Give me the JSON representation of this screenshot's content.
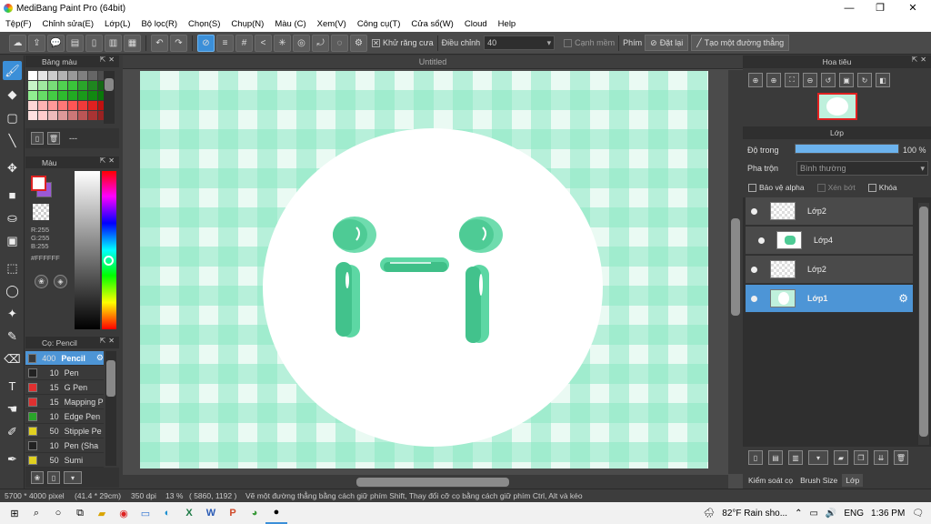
{
  "window": {
    "title": "MediBang Paint Pro (64bit)"
  },
  "menu": [
    "Tệp(F)",
    "Chỉnh sửa(E)",
    "Lớp(L)",
    "Bộ lọc(R)",
    "Chọn(S)",
    "Chụp(N)",
    "Màu (C)",
    "Xem(V)",
    "Công cụ(T)",
    "Cửa sổ(W)",
    "Cloud",
    "Help"
  ],
  "toolbar": {
    "antialias_label": "Khử răng cưa",
    "adjust_label": "Điều chỉnh",
    "adjust_value": "40",
    "soft_edge_label": "Cạnh mềm",
    "key_label": "Phím",
    "reset_label": "Đặt lại",
    "straight_line_label": "Tạo một đường thẳng"
  },
  "palette_panel": {
    "title": "Bảng màu",
    "extra_label": "---"
  },
  "color_panel": {
    "title": "Màu",
    "r": "R:255",
    "g": "G:255",
    "b": "B:255",
    "hex": "#FFFFFF",
    "primary_color": "#ffffff",
    "secondary_color": "#9b59d6"
  },
  "brush_panel": {
    "title": "Cọ: Pencil",
    "brushes": [
      {
        "size": "400",
        "name": "Pencil",
        "color": "#3a3a3a"
      },
      {
        "size": "10",
        "name": "Pen",
        "color": "#222222"
      },
      {
        "size": "15",
        "name": "G Pen",
        "color": "#e03030"
      },
      {
        "size": "15",
        "name": "Mapping P",
        "color": "#e03030"
      },
      {
        "size": "10",
        "name": "Edge Pen",
        "color": "#2aa52a"
      },
      {
        "size": "50",
        "name": "Stipple Pe",
        "color": "#e0d020"
      },
      {
        "size": "10",
        "name": "Pen (Sha",
        "color": "#222222"
      },
      {
        "size": "50",
        "name": "Sumi",
        "color": "#e0d020"
      }
    ]
  },
  "document": {
    "tab_title": "Untitled"
  },
  "navigator": {
    "title": "Hoa tiêu"
  },
  "layer_panel": {
    "title": "Lớp",
    "opacity_label": "Độ trong",
    "opacity_value": "100 %",
    "opacity_fraction": 1.0,
    "blend_label": "Pha trộn",
    "blend_value": "Bình thường",
    "protect_alpha": "Bảo vệ alpha",
    "clip": "Xén bớt",
    "lock": "Khóa",
    "layers": [
      "Lớp2",
      "Lớp4",
      "Lớp2",
      "Lớp1"
    ]
  },
  "right_tabs": [
    "Kiểm soát cọ",
    "Brush Size",
    "Lớp"
  ],
  "status": {
    "size": "5700 * 4000 pixel",
    "cm": "(41.4 * 29cm)",
    "dpi": "350 dpi",
    "zoom": "13 %",
    "coords": "( 5860, 1192 )",
    "hint": "Vẽ một đường thẳng bằng cách giữ phím Shift, Thay đổi cỡ cọ bằng cách giữ phím Ctrl, Alt và kéo"
  },
  "taskbar": {
    "weather": "82°F  Rain sho...",
    "lang": "ENG",
    "time": "1:36 PM"
  }
}
